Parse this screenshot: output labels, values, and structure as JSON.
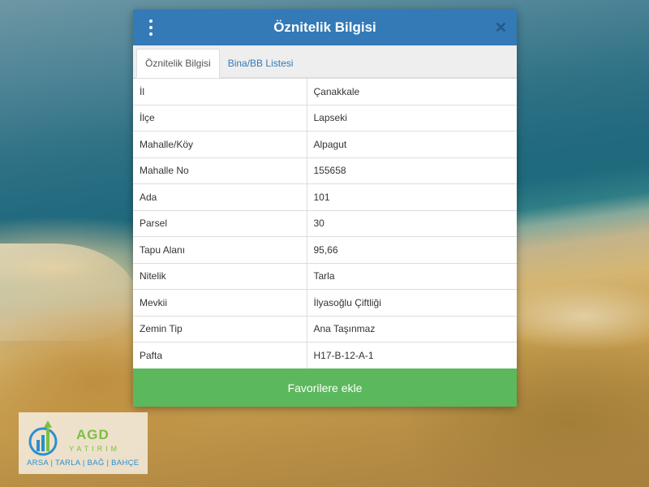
{
  "modal": {
    "title": "Öznitelik Bilgisi",
    "tabs": [
      {
        "label": "Öznitelik Bilgisi",
        "active": true
      },
      {
        "label": "Bina/BB Listesi",
        "active": false
      }
    ],
    "rows": [
      {
        "key": "İl",
        "value": "Çanakkale"
      },
      {
        "key": "İlçe",
        "value": "Lapseki"
      },
      {
        "key": "Mahalle/Köy",
        "value": "Alpagut"
      },
      {
        "key": "Mahalle No",
        "value": "155658"
      },
      {
        "key": "Ada",
        "value": "101"
      },
      {
        "key": "Parsel",
        "value": "30"
      },
      {
        "key": "Tapu Alanı",
        "value": "95,66"
      },
      {
        "key": "Nitelik",
        "value": "Tarla"
      },
      {
        "key": "Mevkii",
        "value": "İlyasoğlu Çiftliği"
      },
      {
        "key": "Zemin Tip",
        "value": "Ana Taşınmaz"
      },
      {
        "key": "Pafta",
        "value": "H17-B-12-A-1"
      }
    ],
    "favorite_label": "Favorilere ekle",
    "icons": {
      "menu": "vertical-dots-icon",
      "close": "close-icon"
    }
  },
  "logo": {
    "name": "AGD",
    "subtitle": "YATIRIM",
    "tagline": "ARSA | TARLA | BAĞ | BAHÇE"
  },
  "colors": {
    "header": "#337ab7",
    "button": "#5cb85c",
    "logo_green": "#7bc043",
    "logo_blue": "#2a8fcf"
  }
}
